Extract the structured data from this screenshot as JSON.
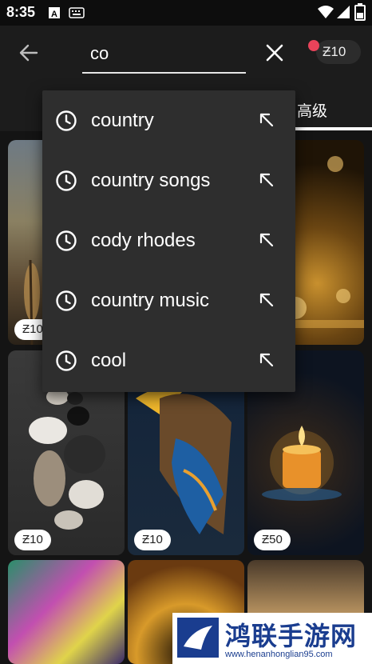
{
  "status": {
    "time": "8:35"
  },
  "search": {
    "query": "co"
  },
  "coins": {
    "balance": "Ƶ10"
  },
  "tabs": {
    "advanced": "高级"
  },
  "suggestions": [
    {
      "label": "country"
    },
    {
      "label": "country songs"
    },
    {
      "label": "cody rhodes"
    },
    {
      "label": "country music"
    },
    {
      "label": "cool"
    }
  ],
  "grid": {
    "prices": [
      "Ƶ10",
      "Ƶ10",
      "Ƶ10",
      "Ƶ50"
    ]
  },
  "watermark": {
    "title": "鸿联手游网",
    "url": "www.henanhonglian95.com"
  },
  "colors": {
    "accent_dot": "#e8435a",
    "background": "#141414",
    "dropdown": "#2e2e2e"
  }
}
